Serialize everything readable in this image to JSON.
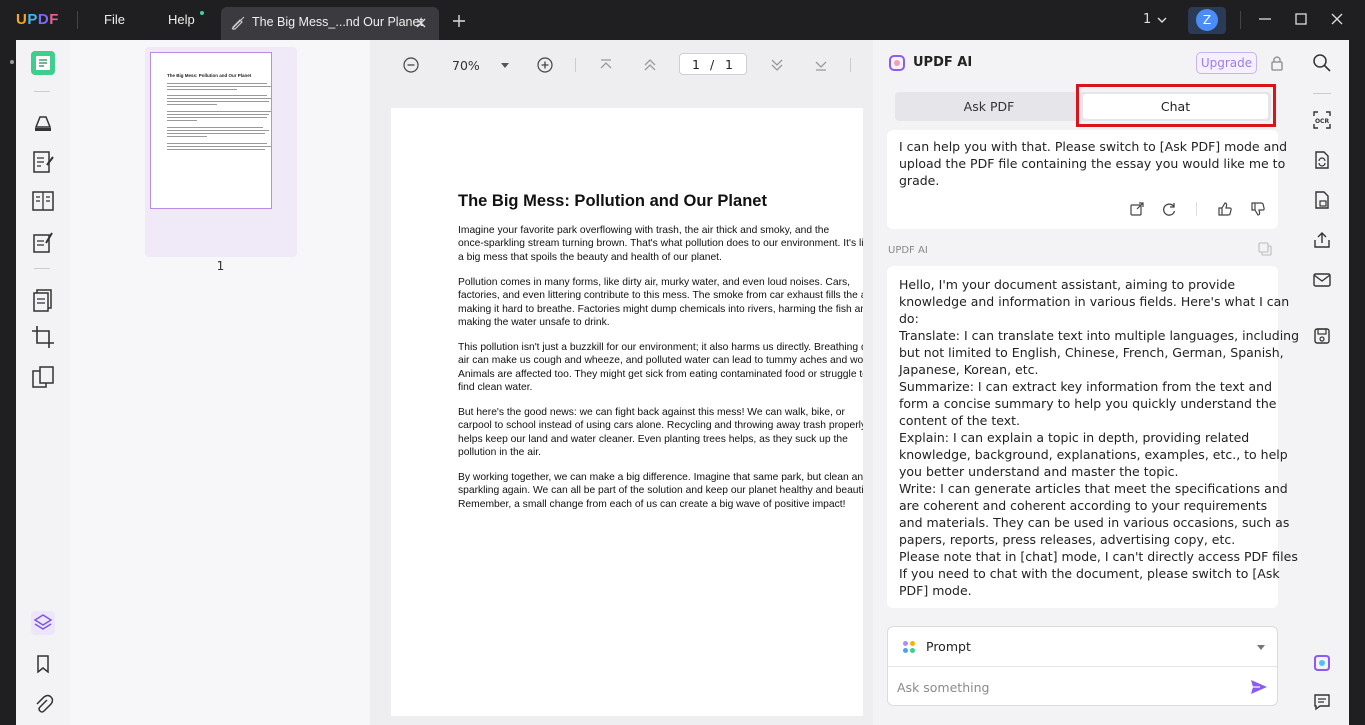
{
  "app": {
    "logo": {
      "u": "U",
      "p": "P",
      "d": "D",
      "f": "F"
    },
    "menu": {
      "file": "File",
      "help": "Help"
    },
    "tab_title": "The Big Mess_...nd Our Planet",
    "page_indicator": "1",
    "avatar_letter": "Z"
  },
  "thumbnails": {
    "page_label": "1",
    "thumb_title": "The Big Mess: Pollution and Our Planet"
  },
  "toolbar": {
    "zoom": "70%",
    "current_page": "1",
    "slash": "/",
    "total_pages": "1"
  },
  "document": {
    "title": "The Big Mess: Pollution and Our Planet",
    "paragraphs": [
      [
        "Imagine your favorite park overflowing with trash, the air thick and smoky, and the",
        "once-sparkling stream turning brown. That's what pollution does to our environment. It's like",
        "a big mess that spoils the beauty and health of our planet."
      ],
      [
        "Pollution comes in many forms, like dirty air, murky water, and even loud noises. Cars,",
        "factories, and even littering contribute to this mess. The smoke from car exhaust fills the air,",
        "making it hard to breathe. Factories might dump chemicals into rivers, harming the fish and",
        "making the water unsafe to drink."
      ],
      [
        "This pollution isn't just a buzzkill for our environment; it also harms us directly. Breathing dirty",
        "air can make us cough and wheeze, and polluted water can lead to tummy aches and worse.",
        "Animals are affected too. They might get sick from eating contaminated food or struggle to",
        "find clean water."
      ],
      [
        "But here's the good news: we can fight back against this mess! We can walk, bike, or",
        "carpool to school instead of using cars alone. Recycling and throwing away trash properly",
        "helps keep our land and water cleaner. Even planting trees helps, as they suck up the",
        "pollution in the air."
      ],
      [
        "By working together, we can make a big difference. Imagine that same park, but clean and",
        "sparkling again. We can all be part of the solution and keep our planet healthy and beautiful.",
        "Remember, a small change from each of us can create a big wave of positive impact!"
      ]
    ]
  },
  "ai": {
    "title": "UPDF AI",
    "upgrade": "Upgrade",
    "tabs": {
      "ask_pdf": "Ask PDF",
      "chat": "Chat"
    },
    "reply_lines": [
      "I can help you with that. Please switch to [Ask PDF] mode and",
      "upload the PDF file containing the essay you would like me to",
      "grade."
    ],
    "sender_label": "UPDF AI",
    "intro_lines": [
      "Hello, I'm your document assistant, aiming to provide",
      "knowledge and information in various fields. Here's what I can",
      "do:",
      "Translate: I can translate text into multiple languages, including",
      "but not limited to English, Chinese, French, German, Spanish,",
      "Japanese, Korean, etc.",
      "Summarize: I can extract key information from the text and",
      "form a concise summary to help you quickly understand the",
      "content of the text.",
      "Explain: I can explain a topic in depth, providing related",
      "knowledge, background, explanations, examples, etc., to help",
      "you better understand and master the topic.",
      "Write: I can generate articles that meet the specifications and",
      "are coherent and coherent according to your requirements",
      "and materials. They can be used in various occasions, such as",
      "papers, reports, press releases, advertising copy, etc.",
      "Please note that in [chat] mode, I can't directly access PDF files.",
      "If you need to chat with the document, please switch to [Ask",
      "PDF] mode."
    ],
    "prompt_label": "Prompt",
    "input_placeholder": "Ask something"
  },
  "colors": {
    "accent": "#8a5cf5",
    "highlight_border": "#d9151c",
    "titlebar": "#1f1f22"
  }
}
